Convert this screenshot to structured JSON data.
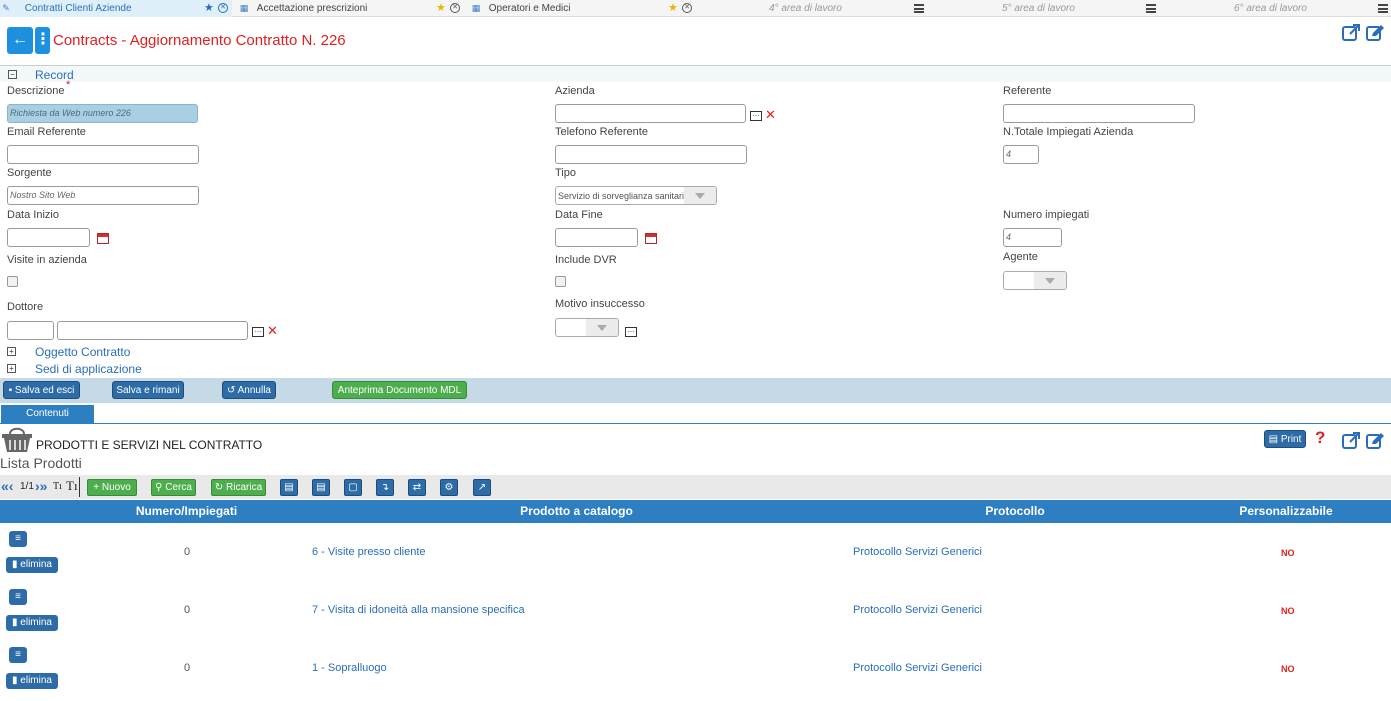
{
  "window_tabs": [
    {
      "label": "Contratti Clienti Aziende",
      "active": true
    },
    {
      "label": "Accettazione prescrizioni",
      "active": false
    },
    {
      "label": "Operatori e Medici",
      "active": false
    }
  ],
  "work_areas": [
    "4° area di lavoro",
    "5° area di lavoro",
    "6° area di lavoro"
  ],
  "header": {
    "title": "Contracts - Aggiornamento Contratto N. 226",
    "back_icon": "←",
    "menu_icon": "⋮"
  },
  "form": {
    "section_record": "Record",
    "descrizione": {
      "label": "Descrizione",
      "required_mark": "*",
      "value": "Richiesta da Web numero 226"
    },
    "azienda": {
      "label": "Azienda",
      "value": ""
    },
    "referente": {
      "label": "Referente",
      "value": ""
    },
    "email_referente": {
      "label": "Email Referente",
      "value": ""
    },
    "telefono_referente": {
      "label": "Telefono Referente",
      "value": ""
    },
    "totale_impiegati": {
      "label": "N.Totale Impiegati Azienda",
      "value": "4"
    },
    "sorgente": {
      "label": "Sorgente",
      "value": "Nostro Sito Web"
    },
    "tipo": {
      "label": "Tipo",
      "value": "Servizio di sorveglianza sanitaria"
    },
    "data_inizio": {
      "label": "Data Inizio",
      "value": ""
    },
    "data_fine": {
      "label": "Data Fine",
      "value": ""
    },
    "numero_impiegati": {
      "label": "Numero impiegati",
      "value": "4"
    },
    "visite_azienda": {
      "label": "Visite in azienda"
    },
    "include_dvr": {
      "label": "Include DVR"
    },
    "agente": {
      "label": "Agente",
      "value": ""
    },
    "dottore": {
      "label": "Dottore",
      "code": "",
      "value": ""
    },
    "motivo_insuccesso": {
      "label": "Motivo insuccesso",
      "value": ""
    },
    "section_oggetto": "Oggetto Contratto",
    "section_sedi": "Sedi di applicazione",
    "dots": "...",
    "clear": "✕",
    "minus": "−",
    "plus": "+"
  },
  "actions": {
    "salva_esci": "Salva ed esci",
    "salva_rimani": "Salva e rimani",
    "annulla": "Annulla",
    "anteprima": "Anteprima Documento MDL"
  },
  "tabs": {
    "contenuti": "Contenuti"
  },
  "products": {
    "title": "PRODOTTI E SERVIZI NEL CONTRATTO",
    "list_title": "Lista Prodotti",
    "print": "Print",
    "help": "?",
    "pager": "1/1",
    "font_small": "Tı",
    "font_large": "Tı",
    "nuovo": "Nuovo",
    "cerca": "Cerca",
    "ricarica": "Ricarica",
    "columns": [
      "Numero/Impiegati",
      "Prodotto a catalogo",
      "Protocollo",
      "Personalizzabile"
    ],
    "rows": [
      {
        "numero": "0",
        "prodotto": "6 - Visite presso cliente",
        "protocollo": "Protocollo Servizi Generici",
        "personalizzabile": "NO"
      },
      {
        "numero": "0",
        "prodotto": "7 - Visita di idoneità alla mansione specifica",
        "protocollo": "Protocollo Servizi Generici",
        "personalizzabile": "NO"
      },
      {
        "numero": "0",
        "prodotto": "1 - Sopralluogo",
        "protocollo": "Protocollo Servizi Generici",
        "personalizzabile": "NO"
      }
    ],
    "delete_label": "elimina"
  },
  "colors": {
    "accent": "#2d7fc1",
    "title_red": "#e02020",
    "green": "#4cae4c"
  }
}
